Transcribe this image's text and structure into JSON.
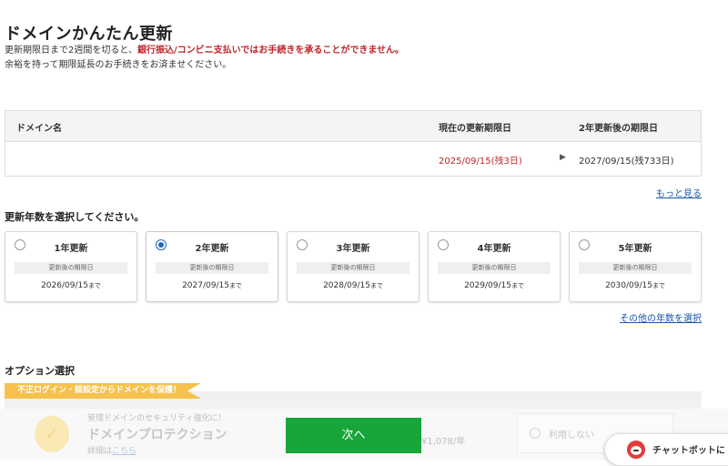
{
  "page": {
    "title": "ドメインかんたん更新"
  },
  "notice": {
    "line1_prefix": "更新期限日まで2週間を切ると、",
    "line1_warning": "銀行振込/コンビニ支払いではお手続きを承ることができません。",
    "line2": "余裕を持って期限延長のお手続きをお済ませください。"
  },
  "domain_table": {
    "headers": {
      "domain": "ドメイン名",
      "current_expiry": "現在の更新期限日",
      "after_expiry": "2年更新後の期限日"
    },
    "row": {
      "domain": "",
      "current_expiry": "2025/09/15(残3日)",
      "arrow": "▶",
      "after_expiry": "2027/09/15(残733日)"
    },
    "more_link": "もっと見る"
  },
  "years": {
    "title": "更新年数を選択してください。",
    "after_label": "更新後の期限日",
    "until_suffix": "まで",
    "options": [
      {
        "label": "1年更新",
        "date": "2026/09/15",
        "selected": false
      },
      {
        "label": "2年更新",
        "date": "2027/09/15",
        "selected": true
      },
      {
        "label": "3年更新",
        "date": "2028/09/15",
        "selected": false
      },
      {
        "label": "4年更新",
        "date": "2029/09/15",
        "selected": false
      },
      {
        "label": "5年更新",
        "date": "2030/09/15",
        "selected": false
      }
    ],
    "other_link": "その他の年数を選択"
  },
  "options": {
    "title": "オプション選択",
    "ribbon": "不正ログイン・誤設定からドメインを保護！",
    "protection": {
      "sub": "管理ドメインのセキュリティ強化に！",
      "name": "ドメインプロテクション",
      "detail_prefix": "詳細は",
      "detail_link": "こちら",
      "price": "¥1,078/年"
    },
    "no_use": "利用しない"
  },
  "actions": {
    "next": "次へ"
  },
  "chatbot": {
    "label": "チャットボットに"
  },
  "colors": {
    "accent_green": "#18a53a",
    "warning_red": "#c0262b",
    "link_blue": "#1a56a8",
    "ribbon_yellow": "#f6c24d"
  }
}
